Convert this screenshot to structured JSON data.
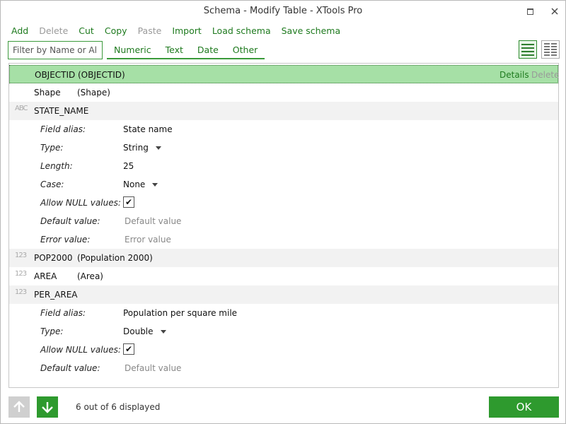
{
  "window": {
    "title": "Schema  -  Modify Table  -  XTools Pro"
  },
  "toolbar": {
    "add": "Add",
    "delete": "Delete",
    "cut": "Cut",
    "copy": "Copy",
    "paste": "Paste",
    "import": "Import",
    "load_schema": "Load schema",
    "save_schema": "Save schema"
  },
  "filter": {
    "placeholder": "Filter by Name or Alias"
  },
  "type_tabs": [
    "Numeric",
    "Text",
    "Date",
    "Other"
  ],
  "fields": {
    "objectid": {
      "name": "OBJECTID",
      "alias": "(OBJECTID)",
      "details": "Details",
      "delete": "Delete"
    },
    "shape": {
      "name": "Shape",
      "alias": "(Shape)"
    },
    "state_name": {
      "icon": "ABC",
      "name": "STATE_NAME",
      "labels": {
        "alias": "Field alias:",
        "type": "Type:",
        "length": "Length:",
        "case": "Case:",
        "allow_null": "Allow NULL values:",
        "default": "Default value:",
        "error": "Error value:"
      },
      "values": {
        "alias": "State name",
        "type": "String",
        "length": "25",
        "case": "None",
        "allow_null_check": "✔",
        "default_placeholder": "Default value",
        "error_placeholder": "Error value"
      }
    },
    "pop2000": {
      "icon": "123",
      "name": "POP2000",
      "alias": "(Population 2000)"
    },
    "area": {
      "icon": "123",
      "name": "AREA",
      "alias": "(Area)"
    },
    "per_area": {
      "icon": "123",
      "name": "PER_AREA",
      "labels": {
        "alias": "Field alias:",
        "type": "Type:",
        "allow_null": "Allow NULL values:",
        "default": "Default value:"
      },
      "values": {
        "alias": "Population per square mile",
        "type": "Double",
        "allow_null_check": "✔",
        "default_placeholder": "Default value"
      }
    }
  },
  "footer": {
    "status": "6 out of 6 displayed",
    "ok": "OK"
  },
  "icons": {
    "maximize": "maximize-icon",
    "close": "close-icon",
    "list_view": "list-view-icon",
    "grid_view": "grid-view-icon",
    "up": "arrow-up-icon",
    "down": "arrow-down-icon"
  },
  "colors": {
    "accent": "#2e9a2e",
    "selected_row": "#a6e0a6",
    "link": "#1e7a1e"
  }
}
